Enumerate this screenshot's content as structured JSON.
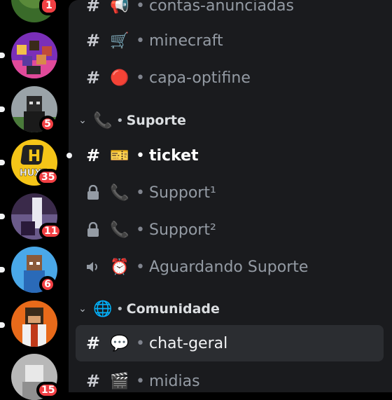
{
  "guilds": [
    {
      "badge": "1"
    },
    {
      "badge": ""
    },
    {
      "badge": "5"
    },
    {
      "badge": "35",
      "logo_text": "HUXF",
      "logo_letter": "H"
    },
    {
      "badge": "11"
    },
    {
      "badge": "6"
    },
    {
      "badge": ""
    },
    {
      "badge": "15"
    }
  ],
  "channels": {
    "contas": {
      "name": "contas-anunciadas",
      "emoji": "📢"
    },
    "minecraft": {
      "name": "minecraft",
      "emoji": "🛒"
    },
    "capa": {
      "name": "capa-optifine",
      "emoji": "🔴"
    },
    "cat_suporte": {
      "name": "Suporte",
      "emoji": "📞"
    },
    "ticket": {
      "name": "ticket",
      "emoji": "🎫"
    },
    "support1": {
      "name": "Support¹",
      "emoji": "📞"
    },
    "support2": {
      "name": "Support²",
      "emoji": "📞"
    },
    "aguardando": {
      "name": "Aguardando Suporte",
      "emoji": "⏰"
    },
    "cat_comunidade": {
      "name": "Comunidade",
      "emoji": "🌐"
    },
    "chat": {
      "name": "chat-geral",
      "emoji": "💬"
    },
    "midias": {
      "name": "midias",
      "emoji": "🎬"
    }
  },
  "symbols": {
    "hash": "#",
    "sep": "•",
    "chevron": "⌄"
  },
  "colors": {
    "accent_red": "#f23f43",
    "sidebar": "#1a1b1e",
    "selected": "#2b2d31"
  }
}
